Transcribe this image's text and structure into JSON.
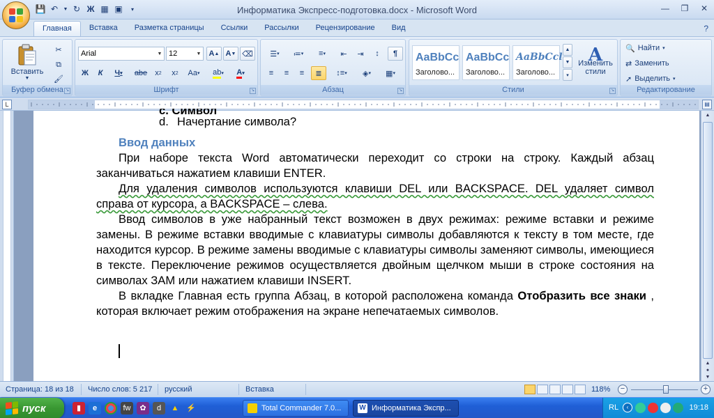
{
  "window": {
    "title": "Информатика Экспресс-подготовка.docx - Microsoft Word"
  },
  "tabs": [
    {
      "label": "Главная",
      "active": true
    },
    {
      "label": "Вставка"
    },
    {
      "label": "Разметка страницы"
    },
    {
      "label": "Ссылки"
    },
    {
      "label": "Рассылки"
    },
    {
      "label": "Рецензирование"
    },
    {
      "label": "Вид"
    }
  ],
  "ribbon": {
    "clipboard": {
      "label": "Буфер обмена",
      "paste": "Вставить"
    },
    "font": {
      "label": "Шрифт",
      "family": "Arial",
      "size": "12"
    },
    "paragraph": {
      "label": "Абзац"
    },
    "styles": {
      "label": "Стили",
      "tiles": [
        {
          "sample": "AaBbCc",
          "name": "Заголово..."
        },
        {
          "sample": "AaBbCc",
          "name": "Заголово..."
        },
        {
          "sample": "AaBbCcl",
          "name": "Заголово..."
        }
      ],
      "change": "Изменить стили"
    },
    "editing": {
      "label": "Редактирование",
      "find": "Найти",
      "replace": "Заменить",
      "select": "Выделить"
    }
  },
  "document": {
    "list_prev": "c.  Символ",
    "list_item": {
      "mark": "d.",
      "text": "Начертание символа?"
    },
    "heading": "Ввод данных",
    "para1": "При наборе текста Word автоматически переходит со строки на строку. Каждый абзац заканчиваться нажатием клавиши ENTER.",
    "para2": "Для удаления символов используются клавиши DEL или BACKSPACE. DEL удаляет символ справа от курсора, а BACKSPACE – слева.",
    "para3": "Ввод символов в уже набранный текст возможен в двух режимах: режиме вставки и режиме замены. В режиме вставки вводимые с клавиатуры символы добавляются к тексту в том месте, где находится курсор. В режиме замены вводимые с клавиатуры символы заменяют символы, имеющиеся в тексте. Переключение режимов осуществляется двойным щелчком мыши в строке состояния на символах ЗАМ или нажатием клавиши INSERT.",
    "para4_start": "В вкладке Главная есть группа Абзац, в которой расположена команда ",
    "para4_bold": "Отобразить все знаки",
    "para4_end": " , которая включает режим отображения на экране непечатаемых символов."
  },
  "status": {
    "page": "Страница: 18 из 18",
    "words": "Число слов: 5 217",
    "language": "русский",
    "mode": "Вставка",
    "zoom": "118%"
  },
  "taskbar": {
    "start": "пуск",
    "tasks": [
      {
        "label": "Total Commander 7.0..."
      },
      {
        "label": "Информатика Экспр..."
      }
    ],
    "lang": "RL",
    "clock": "19:18"
  },
  "colors": {
    "heading": "#4f81bd",
    "ribbon_text": "#15428b"
  }
}
